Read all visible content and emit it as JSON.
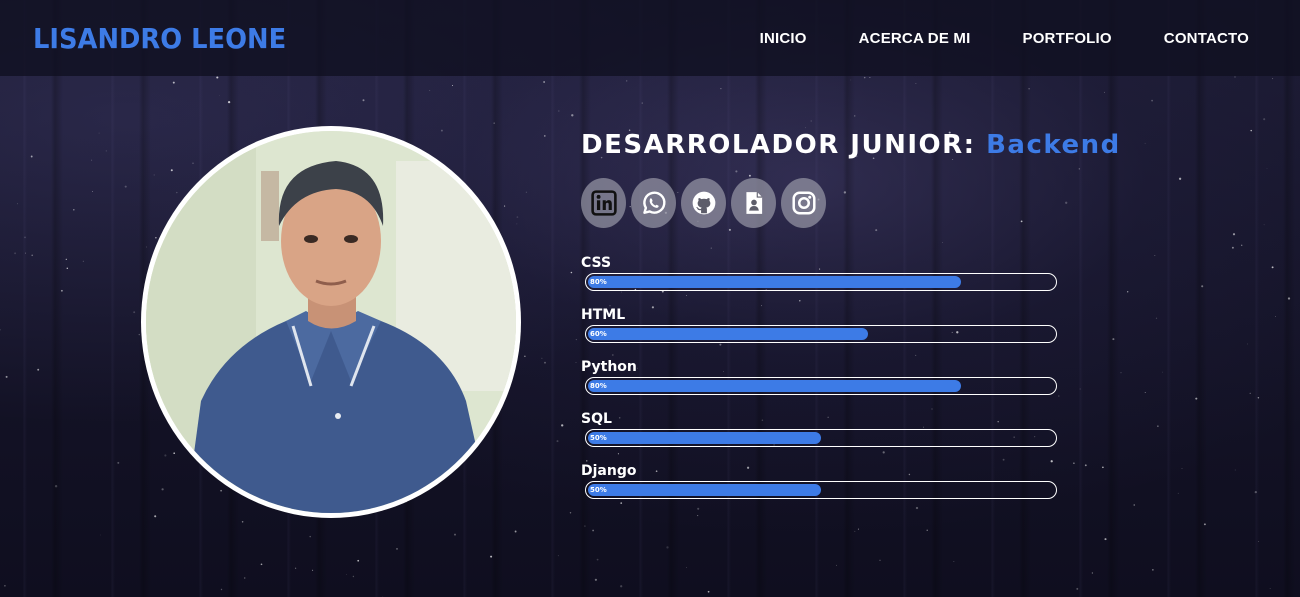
{
  "header": {
    "logo": "LISANDRO LEONE",
    "nav": [
      {
        "label": "INICIO"
      },
      {
        "label": "ACERCA DE MI"
      },
      {
        "label": "PORTFOLIO"
      },
      {
        "label": "CONTACTO"
      }
    ]
  },
  "hero": {
    "headline": "DESARROLADOR JUNIOR:",
    "headline_accent": "Backend",
    "socials": [
      {
        "icon": "linkedin-icon"
      },
      {
        "icon": "whatsapp-icon"
      },
      {
        "icon": "github-icon"
      },
      {
        "icon": "cv-icon"
      },
      {
        "icon": "instagram-icon"
      }
    ],
    "skills": [
      {
        "name": "CSS",
        "percent": 80,
        "label": "80%"
      },
      {
        "name": "HTML",
        "percent": 60,
        "label": "60%"
      },
      {
        "name": "Python",
        "percent": 80,
        "label": "80%"
      },
      {
        "name": "SQL",
        "percent": 50,
        "label": "50%"
      },
      {
        "name": "Django",
        "percent": 50,
        "label": "50%"
      }
    ]
  },
  "colors": {
    "accent": "#3d7be6",
    "header_bg": "#100f20",
    "page_bg": "#16152a"
  }
}
